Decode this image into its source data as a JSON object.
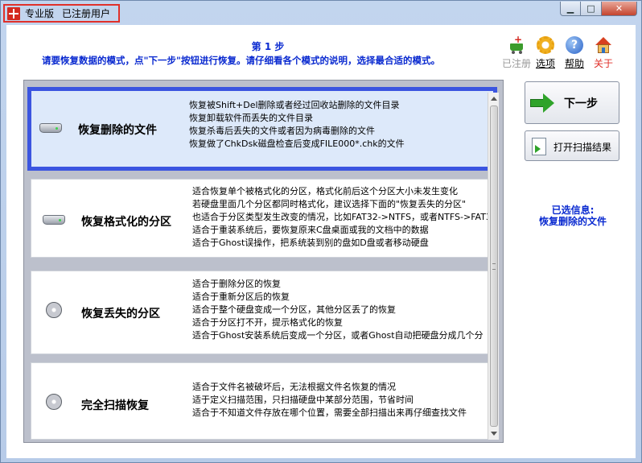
{
  "window": {
    "edition": "专业版",
    "registered": "已注册用户",
    "minimize_label": "▁",
    "maximize_label": "□",
    "close_label": "✕"
  },
  "header": {
    "step_title": "第 1 步",
    "step_desc": "请要恢复数据的模式，点\"下一步\"按钮进行恢复。请仔细看各个模式的说明，选择最合适的模式。"
  },
  "toolbar": {
    "register_label": "已注册",
    "options_label": "选项",
    "help_label": "帮助",
    "about_label": "关于",
    "help_glyph": "?"
  },
  "modes": [
    {
      "name": "恢复删除的文件",
      "lines": [
        "恢复被Shift+Del删除或者经过回收站删除的文件目录",
        "恢复卸载软件而丢失的文件目录",
        "恢复杀毒后丢失的文件或者因为病毒删除的文件",
        "恢复做了ChkDsk磁盘检查后变成FILE000*.chk的文件"
      ]
    },
    {
      "name": "恢复格式化的分区",
      "lines": [
        "适合恢复单个被格式化的分区，格式化前后这个分区大小未发生变化",
        "若硬盘里面几个分区都同时格式化，建议选择下面的\"恢复丢失的分区\"",
        "也适合于分区类型发生改变的情况，比如FAT32->NTFS，或者NTFS->FAT3",
        "适合于重装系统后，要恢复原来C盘桌面或我的文档中的数据",
        "适合于Ghost误操作，把系统装到别的盘如D盘或者移动硬盘"
      ]
    },
    {
      "name": "恢复丢失的分区",
      "lines": [
        "适合于删除分区的恢复",
        "适合于重新分区后的恢复",
        "适合于整个硬盘变成一个分区，其他分区丢了的恢复",
        "适合于分区打不开，提示格式化的恢复",
        "适合于Ghost安装系统后变成一个分区，或者Ghost自动把硬盘分成几个分"
      ]
    },
    {
      "name": "完全扫描恢复",
      "lines": [
        "适合于文件名被破坏后，无法根据文件名恢复的情况",
        "适于定义扫描范围，只扫描硬盘中某部分范围，节省时间",
        "适合于不知道文件存放在哪个位置，需要全部扫描出来再仔细查找文件"
      ]
    }
  ],
  "actions": {
    "next_label": "下一步",
    "open_scan_label": "打开扫描结果"
  },
  "info": {
    "label": "已选信息:",
    "value": "恢复删除的文件"
  }
}
